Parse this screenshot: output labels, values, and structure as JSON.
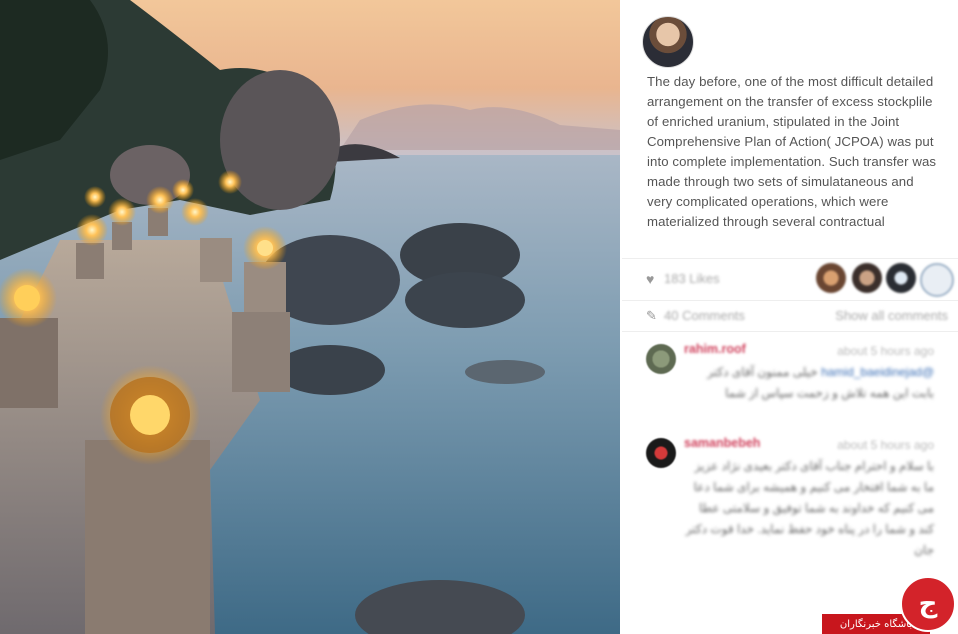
{
  "post": {
    "caption": "The day before, one of the most difficult detailed arrangement on the transfer of excess stockplile of enriched uranium, stipulated in the Joint Comprehensive Plan of Action( JCPOA) was put into complete implementation. Such transfer was made through two sets of simulataneous and very complicated operations, which were materialized through several contractual",
    "likes": "183 Likes",
    "comments_count": "40 Comments",
    "show_all": "Show all comments"
  },
  "comments": [
    {
      "user": "rahim.roof",
      "time": "about 5 hours ago",
      "mention": "@hamid_baeidinejad",
      "text": "خیلی ممنون آقای دکتر بابت این همه تلاش و زحمت سپاس از شما"
    },
    {
      "user": "samanbebeh",
      "time": "about 5 hours ago",
      "text": "با سلام و احترام جناب آقای دکتر بعیدی نژاد عزیز ما به شما افتخار می کنیم و همیشه برای شما دعا می کنیم که خداوند به شما توفیق و سلامتی عطا کند و شما را در پناه خود حفظ نماید. خدا قوت دکتر جان"
    }
  ],
  "watermark": {
    "logo_letter": "ج",
    "label": "باشگاه خبرنگاران"
  },
  "colors": {
    "username": "#d0435e",
    "mention": "#3b6fb6",
    "watermark_red": "#c8161d"
  }
}
